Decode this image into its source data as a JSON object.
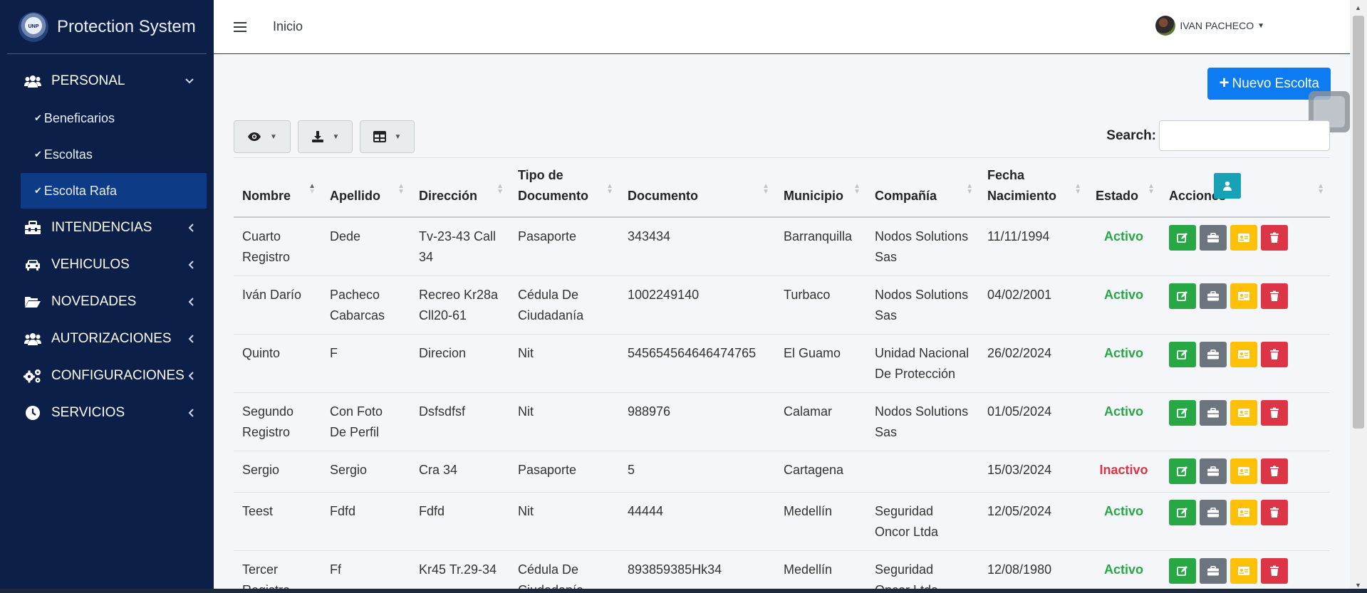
{
  "brand": {
    "name": "Protection System",
    "logo_text": "UNP"
  },
  "sidebar": {
    "items": [
      {
        "label": "PERSONAL",
        "icon": "users-icon",
        "expanded": true,
        "children": [
          {
            "label": "Beneficarios"
          },
          {
            "label": "Escoltas"
          },
          {
            "label": "Escolta Rafa",
            "active": true
          }
        ]
      },
      {
        "label": "INTENDENCIAS",
        "icon": "toolbox-icon"
      },
      {
        "label": "VEHICULOS",
        "icon": "car-icon"
      },
      {
        "label": "NOVEDADES",
        "icon": "folder-open-icon"
      },
      {
        "label": "AUTORIZACIONES",
        "icon": "users-icon"
      },
      {
        "label": "CONFIGURACIONES",
        "icon": "cogs-icon"
      },
      {
        "label": "SERVICIOS",
        "icon": "clock-icon"
      }
    ]
  },
  "topbar": {
    "home": "Inicio",
    "user_name": "IVAN PACHECO"
  },
  "actions": {
    "new_button": "Nuevo Escolta"
  },
  "search": {
    "label": "Search:",
    "value": ""
  },
  "table": {
    "headers": [
      "Nombre",
      "Apellido",
      "Dirección",
      "Tipo de Documento",
      "Documento",
      "Municipio",
      "Compañía",
      "Fecha Nacimiento",
      "Estado",
      "Acciones"
    ],
    "rows": [
      {
        "nombre": "Cuarto Registro",
        "apellido": "Dede",
        "direccion": "Tv-23-43 Call 34",
        "tipo_documento": "Pasaporte",
        "documento": "343434",
        "municipio": "Barranquilla",
        "compania": "Nodos Solutions Sas",
        "fecha_nacimiento": "11/11/1994",
        "estado": "Activo"
      },
      {
        "nombre": "Iván Darío",
        "apellido": "Pacheco Cabarcas",
        "direccion": "Recreo Kr28a Cll20-61",
        "tipo_documento": "Cédula De Ciudadanía",
        "documento": "1002249140",
        "municipio": "Turbaco",
        "compania": "Nodos Solutions Sas",
        "fecha_nacimiento": "04/02/2001",
        "estado": "Activo"
      },
      {
        "nombre": "Quinto",
        "apellido": "F",
        "direccion": "Direcion",
        "tipo_documento": "Nit",
        "documento": "545654564646474765",
        "municipio": "El Guamo",
        "compania": "Unidad Nacional De Protección",
        "fecha_nacimiento": "26/02/2024",
        "estado": "Activo"
      },
      {
        "nombre": "Segundo Registro",
        "apellido": "Con Foto De Perfil",
        "direccion": "Dsfsdfsf",
        "tipo_documento": "Nit",
        "documento": "988976",
        "municipio": "Calamar",
        "compania": "Nodos Solutions Sas",
        "fecha_nacimiento": "01/05/2024",
        "estado": "Activo"
      },
      {
        "nombre": "Sergio",
        "apellido": "Sergio",
        "direccion": "Cra 34",
        "tipo_documento": "Pasaporte",
        "documento": "5",
        "municipio": "Cartagena",
        "compania": "",
        "fecha_nacimiento": "15/03/2024",
        "estado": "Inactivo"
      },
      {
        "nombre": "Teest",
        "apellido": "Fdfd",
        "direccion": "Fdfd",
        "tipo_documento": "Nit",
        "documento": "44444",
        "municipio": "Medellín",
        "compania": "Seguridad Oncor Ltda",
        "fecha_nacimiento": "12/05/2024",
        "estado": "Activo"
      },
      {
        "nombre": "Tercer Registro",
        "apellido": "Ff",
        "direccion": "Kr45 Tr.29-34",
        "tipo_documento": "Cédula De Ciudadanía",
        "documento": "893859385Hk34",
        "municipio": "Medellín",
        "compania": "Seguridad Oncor Ltda",
        "fecha_nacimiento": "12/08/1980",
        "estado": "Activo"
      }
    ]
  },
  "colors": {
    "sidebar": "#0b1f48",
    "active": "#0d3b86",
    "primary": "#0d7cf2",
    "success": "#28a745",
    "info": "#17a2b8",
    "secondary": "#6c757d",
    "warning": "#ffc107",
    "danger": "#dc3545"
  }
}
